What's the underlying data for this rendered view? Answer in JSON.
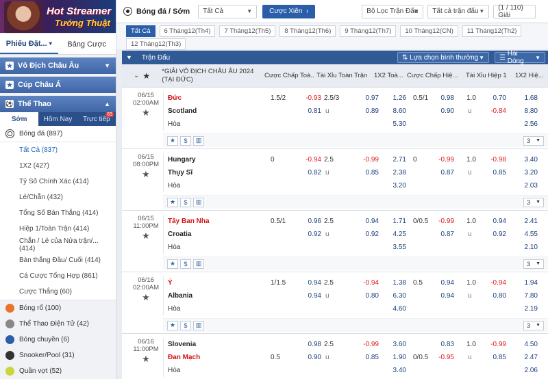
{
  "sidebar": {
    "banner": {
      "title1": "Hot Streamer",
      "title2": "Tướng Thuật"
    },
    "tabs": [
      "Phiếu Đặt...",
      "Bảng Cược"
    ],
    "sections": [
      "Vô Địch Châu Âu",
      "Cúp Châu Á",
      "Thể Thao"
    ],
    "sport_tabs": [
      "Sớm",
      "Hôm Nay",
      "Trực tiếp"
    ],
    "live_count": "83",
    "football": "Bóng đá (897)",
    "football_subs": [
      "Tất Cả (837)",
      "1X2 (427)",
      "Tỷ Số Chính Xác (414)",
      "Lẻ/Chẵn (432)",
      "Tổng Số Bàn Thắng (414)",
      "Hiệp 1/Toàn Trận (414)",
      "Chẵn / Lẻ của Nửa trận/... (414)",
      "Bàn thắng Đầu/ Cuối (414)",
      "Cá Cược Tổng Hợp (861)",
      "Cược Thắng (60)"
    ],
    "sports": [
      "Bóng rổ (100)",
      "Thể Thao Điện Tử (42)",
      "Bóng chuyền (6)",
      "Snooker/Pool (31)",
      "Quần vợt (52)"
    ]
  },
  "topbar": {
    "sport_title": "Bóng đá / Sớm",
    "filter_all": "Tất Cả",
    "xien": "Cược Xiên",
    "league_filter": "Bộ Lọc Trận Đấu",
    "all_matches": "Tất cả trận đấu",
    "pager": "(1 / 110) Giải"
  },
  "dates": [
    [
      "Tất Cả",
      "6 Tháng12(Th4)",
      "7 Tháng12(Th5)",
      "8 Tháng12(Th6)",
      "9 Tháng12(Th7)",
      "10 Tháng12(CN)",
      "11 Tháng12(Th2)"
    ],
    [
      "12 Tháng12(Th3)"
    ]
  ],
  "table": {
    "header_label": "Trận Đấu",
    "sort_option": "Lựa chọn bình thường",
    "lines_option": "Hai Dòng",
    "league": "*GIẢI VÔ ĐỊCH CHÂU ÂU 2024 (TẠI ĐỨC)",
    "columns": [
      "Cược Chấp Toà...",
      "Tài Xỉu Toàn Trận",
      "1X2 Toà...",
      "Cược Chấp Hiệ...",
      "Tài Xỉu Hiệp 1",
      "1X2 Hiệ..."
    ],
    "draw_label": "Hòa",
    "more_label": "3",
    "matches": [
      {
        "date": "06/15",
        "time": "02:00AM",
        "home": "Đức",
        "away": "Scotland",
        "home_fav": true,
        "ft_hdp": {
          "line": "1.5/2",
          "h": "-0.93",
          "a": "0.81",
          "pos": "home"
        },
        "ft_ou": {
          "line": "2.5/3",
          "o": "0.97",
          "u": "0.89",
          "uline": "u"
        },
        "ft_1x2": [
          "1.26",
          "8.60",
          "5.30"
        ],
        "h1_hdp": {
          "line": "0.5/1",
          "h": "0.98",
          "a": "0.90",
          "pos": "home"
        },
        "h1_ou": {
          "line": "1.0",
          "o": "0.70",
          "u": "-0.84",
          "uline": "u"
        },
        "h1_1x2": [
          "1.68",
          "8.80",
          "2.56"
        ]
      },
      {
        "date": "06/15",
        "time": "08:00PM",
        "home": "Hungary",
        "away": "Thụy Sĩ",
        "home_fav": false,
        "ft_hdp": {
          "line": "0",
          "h": "-0.94",
          "a": "0.82",
          "pos": "home"
        },
        "ft_ou": {
          "line": "2.5",
          "o": "-0.99",
          "u": "0.85",
          "uline": "u"
        },
        "ft_1x2": [
          "2.71",
          "2.38",
          "3.20"
        ],
        "h1_hdp": {
          "line": "0",
          "h": "-0.99",
          "a": "0.87",
          "pos": "home"
        },
        "h1_ou": {
          "line": "1.0",
          "o": "-0.98",
          "u": "0.85",
          "uline": "u"
        },
        "h1_1x2": [
          "3.40",
          "3.20",
          "2.03"
        ]
      },
      {
        "date": "06/15",
        "time": "11:00PM",
        "home": "Tây Ban Nha",
        "away": "Croatia",
        "home_fav": true,
        "ft_hdp": {
          "line": "0.5/1",
          "h": "0.96",
          "a": "0.92",
          "pos": "home"
        },
        "ft_ou": {
          "line": "2.5",
          "o": "0.94",
          "u": "0.92",
          "uline": "u"
        },
        "ft_1x2": [
          "1.71",
          "4.25",
          "3.55"
        ],
        "h1_hdp": {
          "line": "0/0.5",
          "h": "-0.99",
          "a": "0.87",
          "pos": "home"
        },
        "h1_ou": {
          "line": "1.0",
          "o": "0.94",
          "u": "0.92",
          "uline": "u"
        },
        "h1_1x2": [
          "2.41",
          "4.55",
          "2.10"
        ]
      },
      {
        "date": "06/16",
        "time": "02:00AM",
        "home": "Ý",
        "away": "Albania",
        "home_fav": true,
        "ft_hdp": {
          "line": "1/1.5",
          "h": "0.94",
          "a": "0.94",
          "pos": "home"
        },
        "ft_ou": {
          "line": "2.5",
          "o": "-0.94",
          "u": "0.80",
          "uline": "u"
        },
        "ft_1x2": [
          "1.38",
          "6.30",
          "4.60"
        ],
        "h1_hdp": {
          "line": "0.5",
          "h": "0.94",
          "a": "0.94",
          "pos": "home"
        },
        "h1_ou": {
          "line": "1.0",
          "o": "-0.94",
          "u": "0.80",
          "uline": "u"
        },
        "h1_1x2": [
          "1.94",
          "7.80",
          "2.19"
        ]
      },
      {
        "date": "06/16",
        "time": "11:00PM",
        "home": "Slovenia",
        "away": "Đan Mạch",
        "home_fav": false,
        "ft_hdp": {
          "line": "0.5",
          "h": "0.98",
          "a": "0.90",
          "pos": "away"
        },
        "ft_ou": {
          "line": "2.5",
          "o": "-0.99",
          "u": "0.85",
          "uline": "u"
        },
        "ft_1x2": [
          "3.60",
          "1.90",
          "3.40"
        ],
        "h1_hdp": {
          "line": "0/0.5",
          "h": "0.83",
          "a": "-0.95",
          "pos": "away"
        },
        "h1_ou": {
          "line": "1.0",
          "o": "-0.99",
          "u": "0.85",
          "uline": "u"
        },
        "h1_1x2": [
          "4.50",
          "2.47",
          "2.06"
        ]
      }
    ]
  },
  "colors": {
    "primary": "#2f5a96",
    "accent": "#2b5ea8",
    "negative": "#e0191e",
    "favorite": "#d01515"
  }
}
